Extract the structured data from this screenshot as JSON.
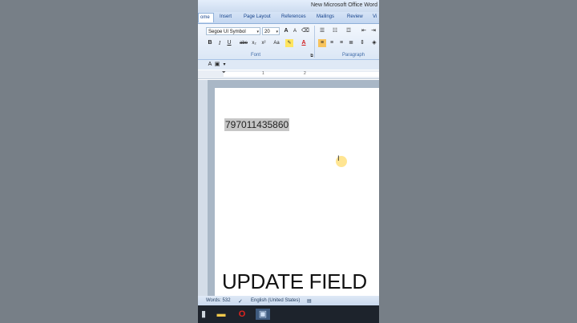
{
  "window": {
    "title": "New Microsoft Office Word"
  },
  "tabs": [
    {
      "label": "ome",
      "active": true
    },
    {
      "label": "Insert"
    },
    {
      "label": "Page Layout"
    },
    {
      "label": "References"
    },
    {
      "label": "Mailings"
    },
    {
      "label": "Review"
    },
    {
      "label": "Vi"
    }
  ],
  "ribbon": {
    "font_name": "Segoe UI Symbol",
    "font_size": "20",
    "group_font": "Font",
    "group_paragraph": "Paragraph",
    "bold": "B",
    "italic": "I",
    "underline": "U",
    "strike": "abe",
    "subscript": "x₂",
    "superscript": "x²",
    "change_case": "Aa",
    "grow_font": "A",
    "shrink_font": "A",
    "font_color": "A"
  },
  "ruler": {
    "marks": [
      "1",
      "2"
    ]
  },
  "document": {
    "selected_text": "797011435860"
  },
  "caption": "UPDATE FIELD",
  "status": {
    "words": "Words: 532",
    "language": "English (United States)"
  },
  "colors": {
    "accent": "#15428b",
    "selection": "#c6c6c6",
    "highlight": "#ffdc6e"
  }
}
